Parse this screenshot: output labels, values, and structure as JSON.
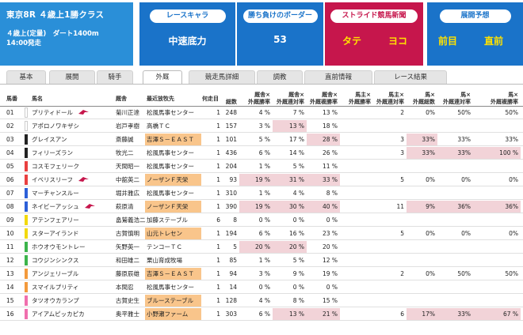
{
  "race": {
    "title": "東京8R ４歳上1勝クラス",
    "condition": "４歳上(定量)　ダート1400m",
    "start": "14:00発走"
  },
  "chara": {
    "label": "レースキャラ",
    "value": "中速底力"
  },
  "border": {
    "label": "勝ち負けのボーダー",
    "value": "53"
  },
  "stride": {
    "label": "ストライド競馬新聞",
    "left": "タテ",
    "right": "ヨコ"
  },
  "yoso": {
    "label": "展開予想",
    "left": "前目",
    "right": "直前"
  },
  "colors": {
    "blue": "#1a73c9",
    "light_blue": "#2a8fd8",
    "crimson": "#c6164c",
    "yellow": "#ffe100",
    "pink": "#f2d3d8",
    "orange": "#f9c58b"
  },
  "tabs": [
    "基本",
    "展開",
    "騎手",
    "外厩",
    "競走馬詳細",
    "調教",
    "直前情報",
    "レース結果"
  ],
  "active_tab": "外厩",
  "columns": {
    "num": "馬番",
    "name": "馬名",
    "trainer": "厩舎",
    "farm": "最近放牧先",
    "first": "何走目",
    "v0": [
      "",
      "総数"
    ],
    "v1": [
      "厩舎×",
      "外厩勝率"
    ],
    "v2": [
      "厩舎×",
      "外厩連対率"
    ],
    "v3": [
      "厩舎×",
      "外厩複勝率"
    ],
    "v4": [
      "馬主×",
      "外厩勝率"
    ],
    "v5": [
      "馬主×",
      "外厩連対率"
    ],
    "v6": [
      "馬×",
      "外厩総数"
    ],
    "v7": [
      "馬×",
      "外厩連対率"
    ],
    "v8": [
      "馬×",
      "外厩複勝率"
    ]
  },
  "rows": [
    {
      "num": "01",
      "name": "プリティドール",
      "trainer": "菊川正達",
      "farm": "松風馬事センター",
      "first": "1",
      "frame": "#ffffff",
      "flag": true,
      "v": [
        "248",
        "4 %",
        "",
        "7 %",
        "",
        "13 %",
        "2",
        "0%",
        "50%",
        "50%"
      ],
      "hl": []
    },
    {
      "num": "02",
      "name": "アポロノワキザシ",
      "trainer": "岩戸孝樹",
      "farm": "高橋ＴＣ",
      "first": "1",
      "frame": "#ffffff",
      "flag": false,
      "v": [
        "157",
        "3 %",
        "",
        "13 %",
        "",
        "18 %",
        "",
        "",
        "",
        ""
      ],
      "hl": [
        3
      ]
    },
    {
      "num": "03",
      "name": "グレイスアン",
      "trainer": "斎藤誠",
      "farm": "吉澤Ｓ－ＥＡＳＴ",
      "first": "1",
      "frame": "#222222",
      "flag": false,
      "v": [
        "101",
        "5 %",
        "",
        "17 %",
        "",
        "28 %",
        "3",
        "33%",
        "33%",
        "33%"
      ],
      "hl": [
        5,
        7
      ],
      "farm_hl": true
    },
    {
      "num": "04",
      "name": "フィリーズラン",
      "trainer": "牧光二",
      "farm": "松風馬事センター",
      "first": "1",
      "frame": "#222222",
      "flag": false,
      "v": [
        "436",
        "6 %",
        "",
        "14 %",
        "",
        "26 %",
        "3",
        "33%",
        "33%",
        "100 %"
      ],
      "hl": [
        7,
        8,
        9
      ]
    },
    {
      "num": "05",
      "name": "コスモフェリーク",
      "trainer": "天間昭一",
      "farm": "松風馬事センター",
      "first": "1",
      "frame": "#e94040",
      "flag": false,
      "v": [
        "204",
        "1 %",
        "",
        "5 %",
        "",
        "11 %",
        "",
        "",
        "",
        ""
      ],
      "hl": []
    },
    {
      "num": "06",
      "name": "イベリスリーフ",
      "trainer": "中舘英二",
      "farm": "ノーザンＦ天栄",
      "first": "1",
      "frame": "#e94040",
      "flag": true,
      "v": [
        "93",
        "19 %",
        "",
        "31 %",
        "",
        "33 %",
        "5",
        "0%",
        "0%",
        "0%"
      ],
      "hl": [
        1,
        3,
        5
      ],
      "farm_hl": true
    },
    {
      "num": "07",
      "name": "マーチャンスルー",
      "trainer": "堀井雅広",
      "farm": "松風馬事センター",
      "first": "1",
      "frame": "#2c5fd8",
      "flag": false,
      "v": [
        "310",
        "1 %",
        "",
        "4 %",
        "",
        "8 %",
        "",
        "",
        "",
        ""
      ],
      "hl": []
    },
    {
      "num": "08",
      "name": "ネイビーアッシュ",
      "trainer": "萩原清",
      "farm": "ノーザンＦ天栄",
      "first": "1",
      "frame": "#2c5fd8",
      "flag": true,
      "v": [
        "390",
        "19 %",
        "",
        "30 %",
        "",
        "40 %",
        "11",
        "9%",
        "36%",
        "36%"
      ],
      "hl": [
        1,
        3,
        5,
        7,
        8,
        9
      ],
      "farm_hl": true
    },
    {
      "num": "09",
      "name": "アテンフェアリー",
      "trainer": "畠鷲義浩二",
      "farm": "加藤ステーブル",
      "first": "6",
      "frame": "#f2d90d",
      "flag": false,
      "v": [
        "8",
        "0 %",
        "",
        "0 %",
        "",
        "0 %",
        "",
        "",
        "",
        ""
      ],
      "hl": []
    },
    {
      "num": "10",
      "name": "スターアイランド",
      "trainer": "古賀慎明",
      "farm": "山元トレセン",
      "first": "1",
      "frame": "#f2d90d",
      "flag": false,
      "v": [
        "194",
        "6 %",
        "",
        "16 %",
        "",
        "23 %",
        "5",
        "0%",
        "0%",
        "0%"
      ],
      "hl": [],
      "farm_hl": true
    },
    {
      "num": "11",
      "name": "ホウオウモントレー",
      "trainer": "矢野英一",
      "farm": "テンコーＴＣ",
      "first": "1",
      "frame": "#3cb44b",
      "flag": false,
      "v": [
        "5",
        "20 %",
        "",
        "20 %",
        "",
        "20 %",
        "",
        "",
        "",
        ""
      ],
      "hl": [
        1,
        3
      ]
    },
    {
      "num": "12",
      "name": "コウジンシンクス",
      "trainer": "和田雄二",
      "farm": "栗山育成牧場",
      "first": "1",
      "frame": "#3cb44b",
      "flag": false,
      "v": [
        "85",
        "1 %",
        "",
        "5 %",
        "",
        "12 %",
        "",
        "",
        "",
        ""
      ],
      "hl": []
    },
    {
      "num": "13",
      "name": "アンジェリーブル",
      "trainer": "藤原辰雄",
      "farm": "吉澤Ｓ－ＥＡＳＴ",
      "first": "1",
      "frame": "#f39a3c",
      "flag": false,
      "v": [
        "94",
        "3 %",
        "",
        "9 %",
        "",
        "19 %",
        "2",
        "0%",
        "50%",
        "50%"
      ],
      "hl": [],
      "farm_hl": true
    },
    {
      "num": "14",
      "name": "スマイルプリティ",
      "trainer": "本間忍",
      "farm": "松風馬事センター",
      "first": "1",
      "frame": "#f39a3c",
      "flag": false,
      "v": [
        "14",
        "0 %",
        "",
        "0 %",
        "",
        "0 %",
        "",
        "",
        "",
        ""
      ],
      "hl": []
    },
    {
      "num": "15",
      "name": "タツオウカランプ",
      "trainer": "古賀史生",
      "farm": "ブルーステーブル",
      "first": "1",
      "frame": "#f06fae",
      "flag": false,
      "v": [
        "128",
        "4 %",
        "",
        "8 %",
        "",
        "15 %",
        "",
        "",
        "",
        ""
      ],
      "hl": [],
      "farm_hl": true
    },
    {
      "num": "16",
      "name": "アイアムピッカピカ",
      "trainer": "奥平雅士",
      "farm": "小野瀬ファーム",
      "first": "1",
      "frame": "#f06fae",
      "flag": false,
      "v": [
        "303",
        "6 %",
        "",
        "13 %",
        "",
        "21 %",
        "6",
        "17%",
        "33%",
        "67 %"
      ],
      "hl": [
        3,
        5,
        7,
        8,
        9
      ],
      "farm_hl": true
    }
  ]
}
